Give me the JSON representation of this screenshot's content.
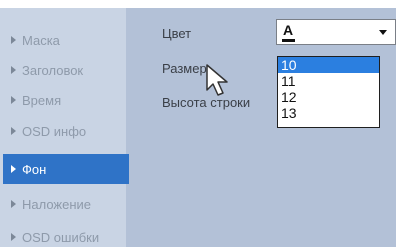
{
  "sidebar": {
    "items": [
      {
        "label": "Маска",
        "active": false
      },
      {
        "label": "Заголовок",
        "active": false
      },
      {
        "label": "Время",
        "active": false
      },
      {
        "label": "OSD инфо",
        "active": false
      },
      {
        "label": "Фон",
        "active": true
      },
      {
        "label": "Наложение",
        "active": false
      },
      {
        "label": "OSD ошибки",
        "active": false
      }
    ]
  },
  "form": {
    "color_label": "Цвет",
    "size_label": "Размер",
    "line_height_label": "Высота строки",
    "color_select_value": "A",
    "size_options": [
      "10",
      "11",
      "12",
      "13"
    ],
    "size_selected": "10"
  },
  "icons": {
    "nav_arrow": "triangle-right-icon",
    "dropdown": "chevron-down-icon",
    "pointer": "mouse-pointer-icon"
  },
  "colors": {
    "panel_bg": "#b3c1d7",
    "sidebar_bg": "#c9d4e4",
    "active_item": "#2f73c7",
    "selected_option": "#2b7fe0"
  }
}
